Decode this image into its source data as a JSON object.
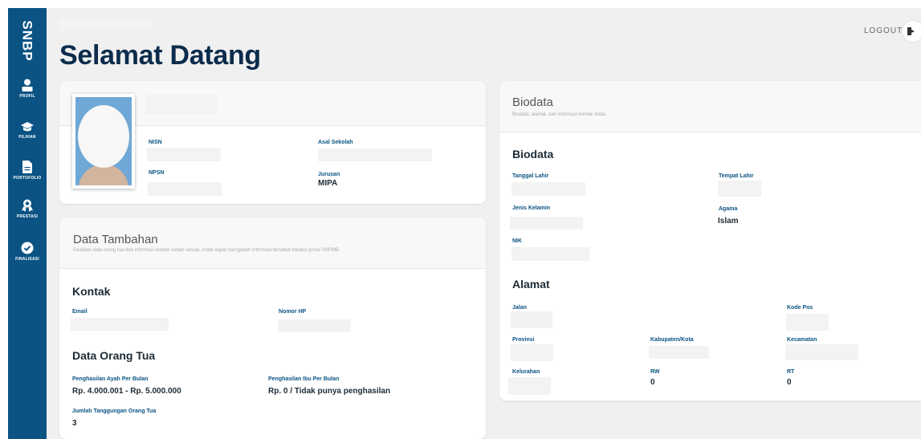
{
  "app": {
    "logo": "SNBP"
  },
  "sidebar": {
    "items": [
      {
        "label": "PROFIL",
        "icon": "user-icon"
      },
      {
        "label": "PILIHAN",
        "icon": "graduation-cap-icon"
      },
      {
        "label": "PORTOFOLIO",
        "icon": "file-icon"
      },
      {
        "label": "PRESTASI",
        "icon": "award-icon"
      },
      {
        "label": "FINALISASI",
        "icon": "check-circle-icon"
      }
    ]
  },
  "header": {
    "title": "Selamat Datang",
    "logout_label": "LOGOUT"
  },
  "profile": {
    "nisn_label": "NISN",
    "npsn_label": "NPSN",
    "sekolah_label": "Asal Sekolah",
    "jurusan_label": "Jurusan",
    "jurusan_value": "MIPA"
  },
  "tambahan": {
    "title": "Data Tambahan",
    "subtitle": "Pastikan data orang tua dan informasi kontak sudah sesuai. Anda dapat mengubah informasi tersebut melalui portal SNPMB.",
    "kontak_heading": "Kontak",
    "email_label": "Email",
    "hp_label": "Nomor HP",
    "ortu_heading": "Data Orang Tua",
    "ayah_label": "Penghasilan Ayah Per Bulan",
    "ayah_value": "Rp. 4.000.001 - Rp. 5.000.000",
    "ibu_label": "Penghasilan Ibu Per Bulan",
    "ibu_value": "Rp. 0 / Tidak punya penghasilan",
    "tanggungan_label": "Jumlah Tanggungan Orang Tua",
    "tanggungan_value": "3"
  },
  "biodata": {
    "title": "Biodata",
    "subtitle": "Biodata, alamat, dan informasi kontak Anda.",
    "heading": "Biodata",
    "tgl_lahir_label": "Tanggal Lahir",
    "tempat_lahir_label": "Tempat Lahir",
    "jk_label": "Jenis Kelamin",
    "agama_label": "Agama",
    "agama_value": "Islam",
    "nik_label": "NIK",
    "alamat_heading": "Alamat",
    "jalan_label": "Jalan",
    "kodepos_label": "Kode Pos",
    "provinsi_label": "Provinsi",
    "kabupaten_label": "Kabupaten/Kota",
    "kecamatan_label": "Kecamatan",
    "kelurahan_label": "Kelurahan",
    "rw_label": "RW",
    "rw_value": "0",
    "rt_label": "RT",
    "rt_value": "0"
  },
  "colors": {
    "sidebar": "#0a5383",
    "title": "#0c2c4c",
    "label": "#0a5383",
    "background": "#f0f0f0"
  }
}
